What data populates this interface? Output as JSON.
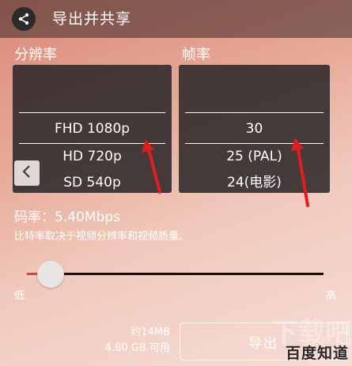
{
  "header": {
    "title": "导出并共享"
  },
  "resolution": {
    "label": "分辨率",
    "options": [
      "FHD 1080p",
      "HD 720p",
      "SD 540p"
    ],
    "selected": "FHD 1080p"
  },
  "framerate": {
    "label": "帧率",
    "options": [
      "30",
      "25 (PAL)",
      "24(电影)"
    ],
    "selected": "30"
  },
  "bitrate": {
    "text": "码率：5.40Mbps",
    "hint": "比特率取决于视频分辨率和视频质量。",
    "slider_level": 0.08,
    "low_label": "低",
    "high_label": "高"
  },
  "footer": {
    "size_estimate": "约14MB",
    "available": "4.80 GB 可用",
    "export_label": "导出"
  },
  "watermark": {
    "text": "百度知道",
    "bg_text": "下载吧"
  },
  "colors": {
    "accent": "#e0403a",
    "annotation_arrow": "#e01e1e"
  }
}
